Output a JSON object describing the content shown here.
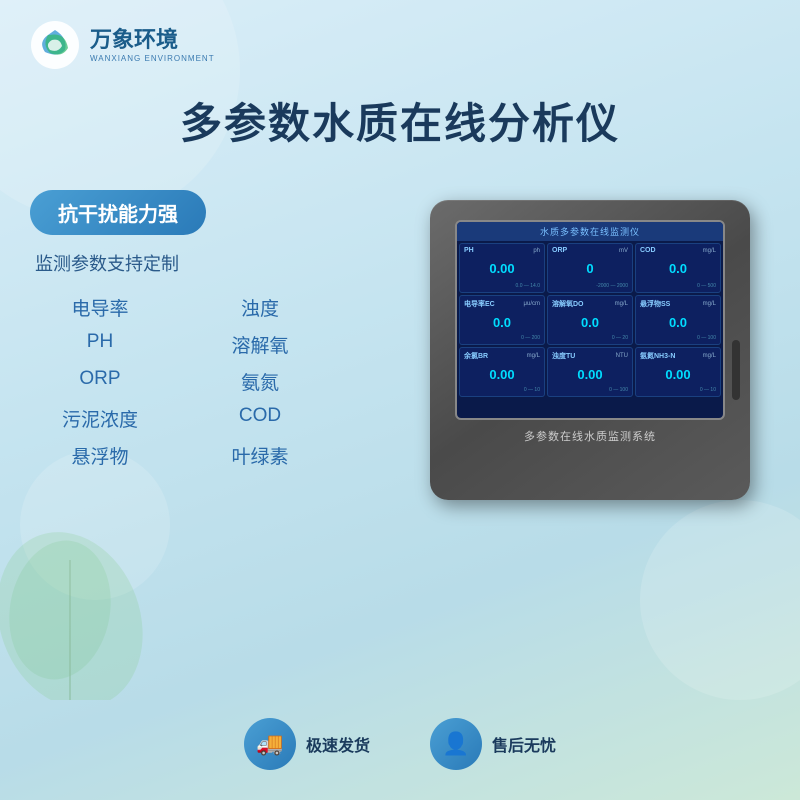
{
  "brand": {
    "logo_main": "万象环境",
    "logo_sub": "WANXIANG ENVIRONMENT"
  },
  "main_title": "多参数水质在线分析仪",
  "left_panel": {
    "badge": "抗干扰能力强",
    "subtitle": "监测参数支持定制",
    "features": [
      {
        "label": "电导率"
      },
      {
        "label": "浊度"
      },
      {
        "label": "PH"
      },
      {
        "label": "溶解氧"
      },
      {
        "label": "ORP"
      },
      {
        "label": "氨氮"
      },
      {
        "label": "污泥浓度"
      },
      {
        "label": "COD"
      },
      {
        "label": "悬浮物"
      },
      {
        "label": "叶绿素"
      }
    ]
  },
  "device": {
    "screen_title": "水质多参数在线监测仪",
    "device_label": "多参数在线水质监测系统",
    "cells": [
      {
        "param": "PH",
        "unit": "ph",
        "value": "0.00"
      },
      {
        "param": "ORP",
        "unit": "mV",
        "value": "0"
      },
      {
        "param": "COD",
        "unit": "mg/L",
        "value": "0.0"
      },
      {
        "param": "电导率EC",
        "unit": "μu/cm",
        "value": "0.0"
      },
      {
        "param": "溶解氧DO",
        "unit": "mg/L",
        "value": "0.0"
      },
      {
        "param": "悬浮物SS",
        "unit": "mg/L",
        "value": "0.0"
      },
      {
        "param": "余氯BR",
        "unit": "mg/L",
        "value": "0.00"
      },
      {
        "param": "浊度TU",
        "unit": "NTU",
        "value": "0.00"
      },
      {
        "param": "氨氮NH3-N",
        "unit": "mg/L",
        "value": "0.00"
      }
    ]
  },
  "bottom": {
    "item1_icon": "🚚",
    "item1_text": "极速发货",
    "item2_icon": "👤",
    "item2_text": "售后无忧"
  }
}
